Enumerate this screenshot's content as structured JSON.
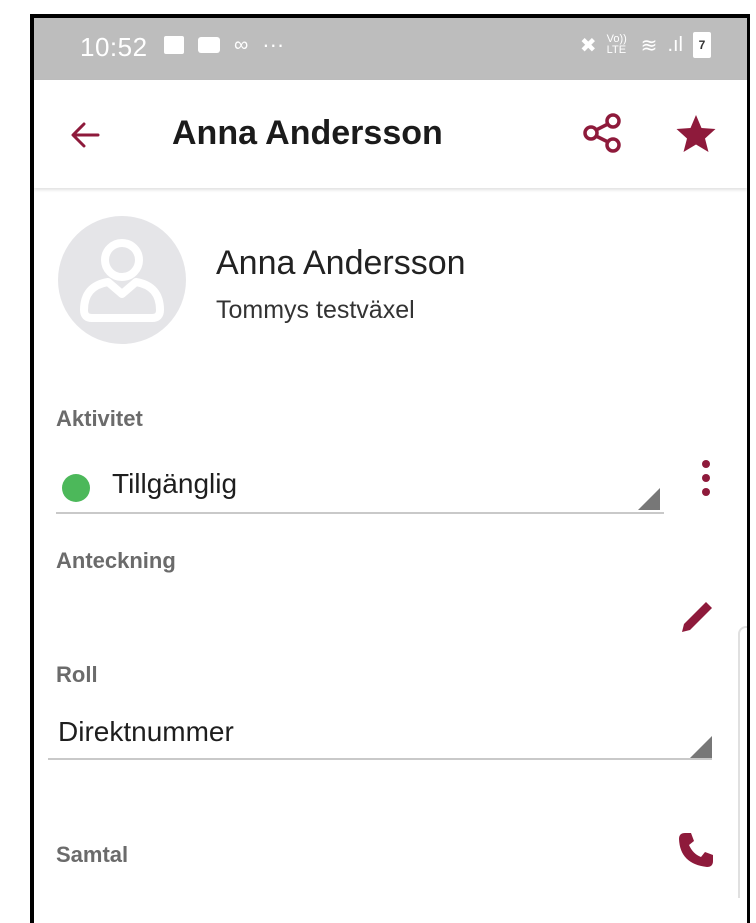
{
  "status_bar": {
    "time": "10:52",
    "dots": "···",
    "volte": "Vo)) LTE",
    "battery": "7"
  },
  "app_bar": {
    "title": "Anna Andersson"
  },
  "profile": {
    "name": "Anna Andersson",
    "organization": "Tommys testväxel"
  },
  "activity": {
    "label": "Aktivitet",
    "value": "Tillgänglig",
    "status_color": "#4cb85a"
  },
  "note": {
    "label": "Anteckning"
  },
  "role": {
    "label": "Roll",
    "value": "Direktnummer"
  },
  "calls": {
    "label": "Samtal"
  },
  "colors": {
    "accent": "#8e1a3b",
    "status_bar": "#bdbdbd"
  }
}
